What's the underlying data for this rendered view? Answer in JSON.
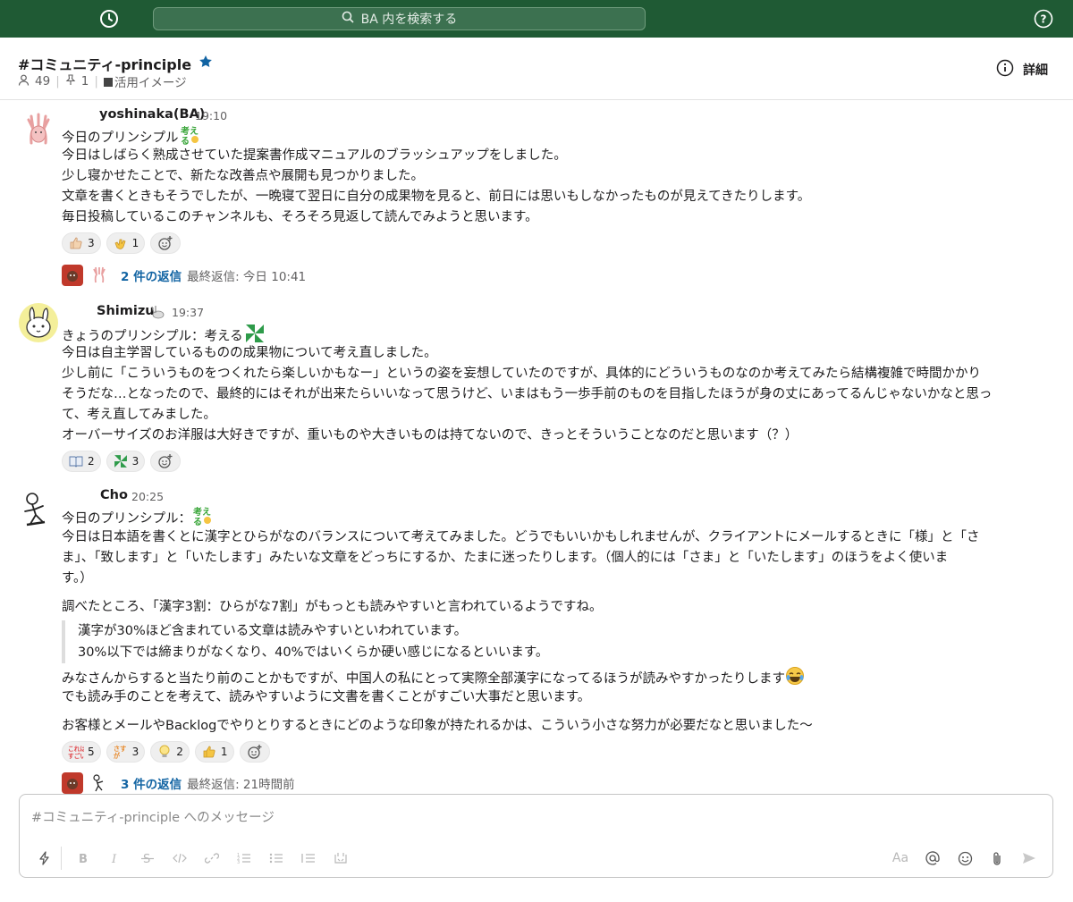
{
  "topbar": {
    "search_placeholder": "BA 内を検索する",
    "history_icon": "clock-icon",
    "help_icon": "help-icon",
    "bg_color": "#1f5a34"
  },
  "channel": {
    "name": "#コミュニティ-principle",
    "members": "49",
    "pins": "1",
    "bookmark": "活用イメージ",
    "details_label": "詳細"
  },
  "messages": [
    {
      "user": "yoshinaka(BA)",
      "time": "19:10",
      "lines": [
        "今日のプリンシプル",
        "今日はしばらく熟成させていた提案書作成マニュアルのブラッシュアップをしました。",
        "少し寝かせたことで、新たな改善点や展開も見つかりました。",
        "文章を書くときもそうでしたが、一晩寝て翌日に自分の成果物を見ると、前日には思いもしなかったものが見えてきたりします。",
        "毎日投稿しているこのチャンネルも、そろそろ見返して読んでみようと思います。"
      ],
      "reactions": [
        {
          "icon": "thumbs-up-icon",
          "count": "3"
        },
        {
          "icon": "clap-icon",
          "count": "1"
        }
      ],
      "thread": {
        "replies": "2 件の返信",
        "last": "最終返信: 今日 10:41"
      }
    },
    {
      "user": "Shimizu",
      "time": "19:37",
      "lines": [
        "きょうのプリンシプル：考える",
        "今日は自主学習しているものの成果物について考え直しました。",
        "少し前に「こういうものをつくれたら楽しいかもなー」というの姿を妄想していたのですが、具体的にどういうものなのか考えてみたら結構複雑で時間かかり",
        "そうだな…となったので、最終的にはそれが出来たらいいなって思うけど、いまはもう一歩手前のものを目指したほうが身の丈にあってるんじゃないかなと思っ",
        "て、考え直してみました。",
        "オーバーサイズのお洋服は大好きですが、重いものや大きいものは持てないので、きっとそういうことなのだと思います（？）"
      ],
      "reactions": [
        {
          "icon": "book-icon",
          "count": "2"
        },
        {
          "icon": "pinwheel-icon",
          "count": "3"
        }
      ]
    },
    {
      "user": "Cho",
      "time": "20:25",
      "lines": [
        "今日のプリンシプル：",
        "今日は日本語を書くとに漢字とひらがなのバランスについて考えてみました。どうでもいいかもしれませんが、クライアントにメールするときに「様」と「さ",
        "ま」、「致します」と「いたします」みたいな文章をどっちにするか、たまに迷ったりします。（個人的には「さま」と「いたします」のほうをよく使いま",
        "す。）",
        "調べたところ、「漢字3割：ひらがな7割」がもっとも読みやすいと言われているようですね。",
        "みなさんからすると当たり前のことかもですが、中国人の私にとって実際全部漢字になってるほうが読みやすかったりします",
        "でも読み手のことを考えて、読みやすいように文書を書くことがすごい大事だと思います。",
        "お客様とメールやBacklogでやりとりするときにどのような印象が持たれるかは、こういう小さな努力が必要だなと思いました〜"
      ],
      "quote": [
        "漢字が30%ほど含まれている文章は読みやすいといわれています。",
        "30%以下では締まりがなくなり、40%ではいくらか硬い感じになるといいます。"
      ],
      "reactions": [
        {
          "icon": "koreha-sugoi-icon",
          "count": "5"
        },
        {
          "icon": "sasuga-icon",
          "count": "3"
        },
        {
          "icon": "bulb-icon",
          "count": "2"
        },
        {
          "icon": "thumbs-up-icon",
          "count": "1"
        }
      ],
      "thread": {
        "replies": "3 件の返信",
        "last": "最終返信: 21時間前"
      }
    }
  ],
  "composer": {
    "placeholder": "#コミュニティ-principle へのメッセージ",
    "format_label": "Aa"
  }
}
